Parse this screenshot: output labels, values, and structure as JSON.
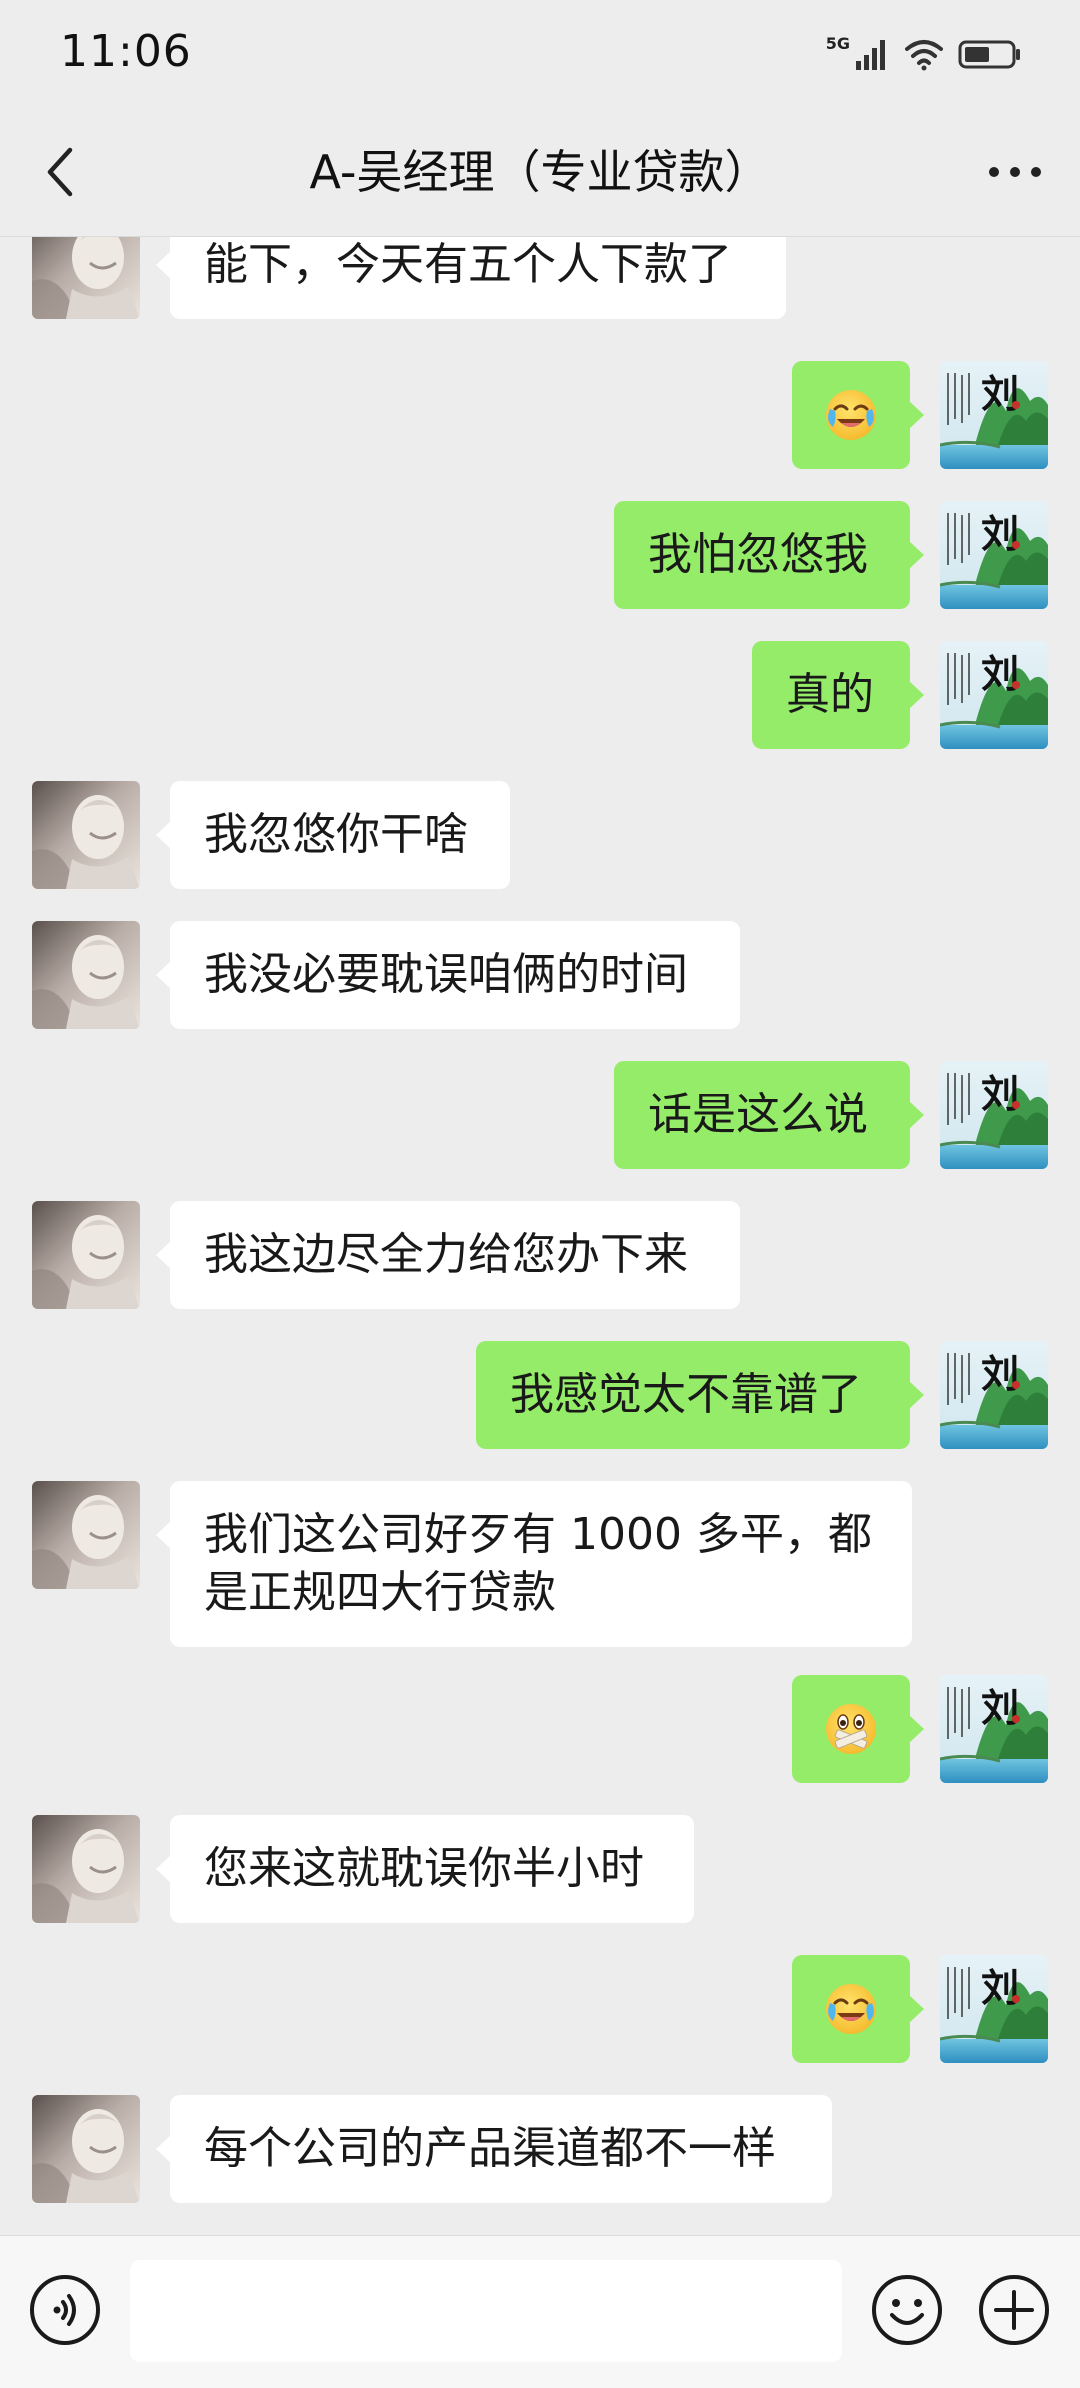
{
  "status_bar": {
    "time": "11:06",
    "network": "5G",
    "signal_icon": "cellular-signal-icon",
    "wifi_icon": "wifi-icon",
    "battery_icon": "battery-icon"
  },
  "header": {
    "title": "A-吴经理（专业贷款）",
    "back_icon": "chevron-left-icon",
    "more_icon": "more-dots-icon"
  },
  "messages": [
    {
      "side": "in",
      "text": "能下，今天有五个人下款了"
    },
    {
      "side": "out",
      "emoji": "face-crying-laughing"
    },
    {
      "side": "out",
      "text": "我怕忽悠我"
    },
    {
      "side": "out",
      "text": "真的"
    },
    {
      "side": "in",
      "text": "我忽悠你干啥"
    },
    {
      "side": "in",
      "text": "我没必要耽误咱俩的时间"
    },
    {
      "side": "out",
      "text": "话是这么说"
    },
    {
      "side": "in",
      "text": "我这边尽全力给您办下来"
    },
    {
      "side": "out",
      "text": "我感觉太不靠谱了"
    },
    {
      "side": "in",
      "text": "我们这公司好歹有 1000 多平，都是正规四大行贷款"
    },
    {
      "side": "out",
      "emoji": "face-shushing-tape"
    },
    {
      "side": "in",
      "text": "您来这就耽误你半小时"
    },
    {
      "side": "out",
      "emoji": "face-crying-laughing"
    },
    {
      "side": "in",
      "text": "每个公司的产品渠道都不一样"
    }
  ],
  "avatars": {
    "contact": "contact-avatar-sculpture",
    "self": "self-avatar-calligraphy-landscape",
    "self_glyph": "刘"
  },
  "input_bar": {
    "placeholder": "",
    "value": "",
    "voice_icon": "voice-input-icon",
    "emoji_icon": "emoji-face-icon",
    "plus_icon": "plus-circle-icon"
  },
  "colors": {
    "background": "#ededed",
    "bubble_out": "#95ec69",
    "bubble_in": "#ffffff",
    "text": "#191919"
  }
}
